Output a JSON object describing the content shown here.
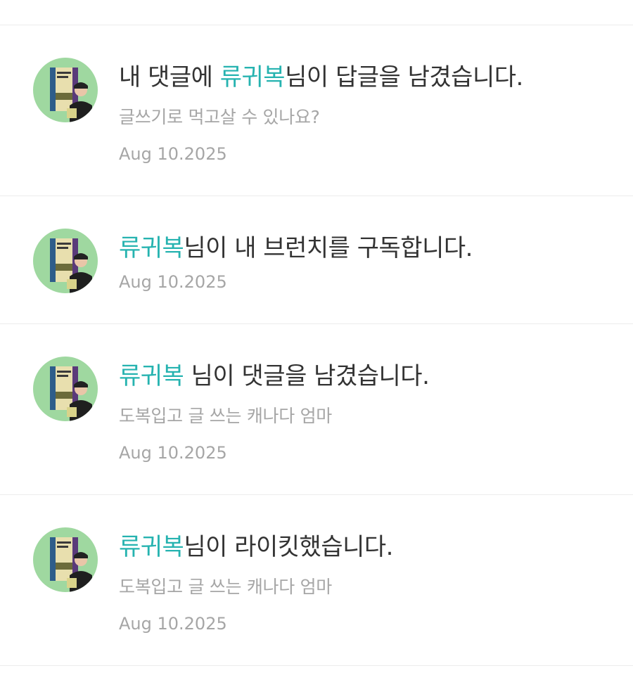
{
  "notifications": [
    {
      "prefix": "내 댓글에 ",
      "user": "류귀복",
      "suffix": "님이 답글을 남겼습니다.",
      "subtitle": "글쓰기로 먹고살 수 있나요?",
      "date": "Aug 10.2025"
    },
    {
      "prefix": "",
      "user": "류귀복",
      "suffix": "님이 내 브런치를 구독합니다.",
      "subtitle": "",
      "date": "Aug 10.2025"
    },
    {
      "prefix": "",
      "user": "류귀복",
      "suffix": " 님이 댓글을 남겼습니다.",
      "subtitle": "도복입고 글 쓰는 캐나다 엄마",
      "date": "Aug 10.2025"
    },
    {
      "prefix": "",
      "user": "류귀복",
      "suffix": "님이 라이킷했습니다.",
      "subtitle": "도복입고 글 쓰는 캐나다 엄마",
      "date": "Aug 10.2025"
    }
  ],
  "colors": {
    "username": "#26b3b0",
    "title": "#333333",
    "meta": "#a6a6a6",
    "avatar_bg": "#9fd8a0"
  },
  "icons": [
    "avatar-book-person"
  ]
}
